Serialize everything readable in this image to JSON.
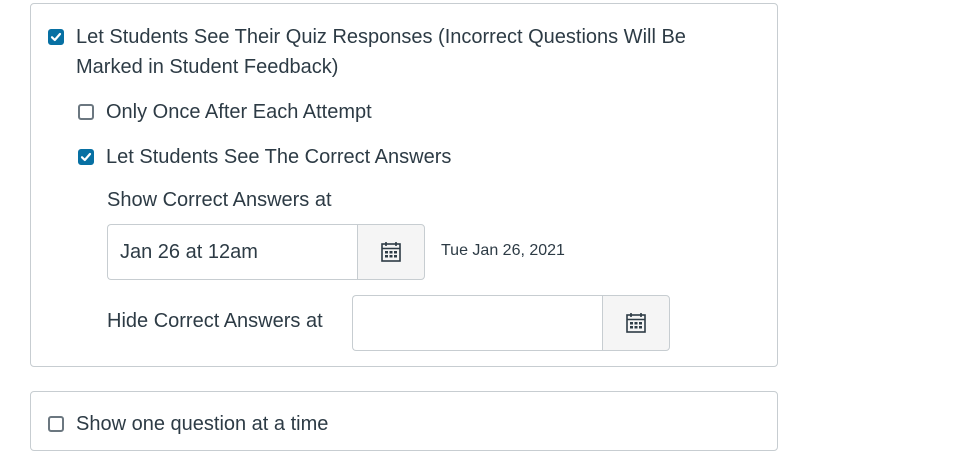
{
  "quiz_options": {
    "see_responses": {
      "checked": true,
      "line1": "Let Students See Their Quiz Responses (Incorrect Questions Will Be",
      "line2": "Marked in Student Feedback)"
    },
    "only_once": {
      "checked": false,
      "label": "Only Once After Each Attempt"
    },
    "see_correct": {
      "checked": true,
      "label": "Let Students See The Correct Answers"
    },
    "show_at": {
      "label": "Show Correct Answers at",
      "value": "Jan 26 at 12am",
      "formatted": "Tue Jan 26, 2021",
      "calendar_icon": "calendar-icon"
    },
    "hide_at": {
      "label": "Hide Correct Answers at",
      "value": "",
      "calendar_icon": "calendar-icon"
    },
    "one_question": {
      "checked": false,
      "label": "Show one question at a time"
    }
  },
  "colors": {
    "checkbox_checked": "#0770a3",
    "text": "#2d3b45",
    "border": "#c7cdd1"
  }
}
